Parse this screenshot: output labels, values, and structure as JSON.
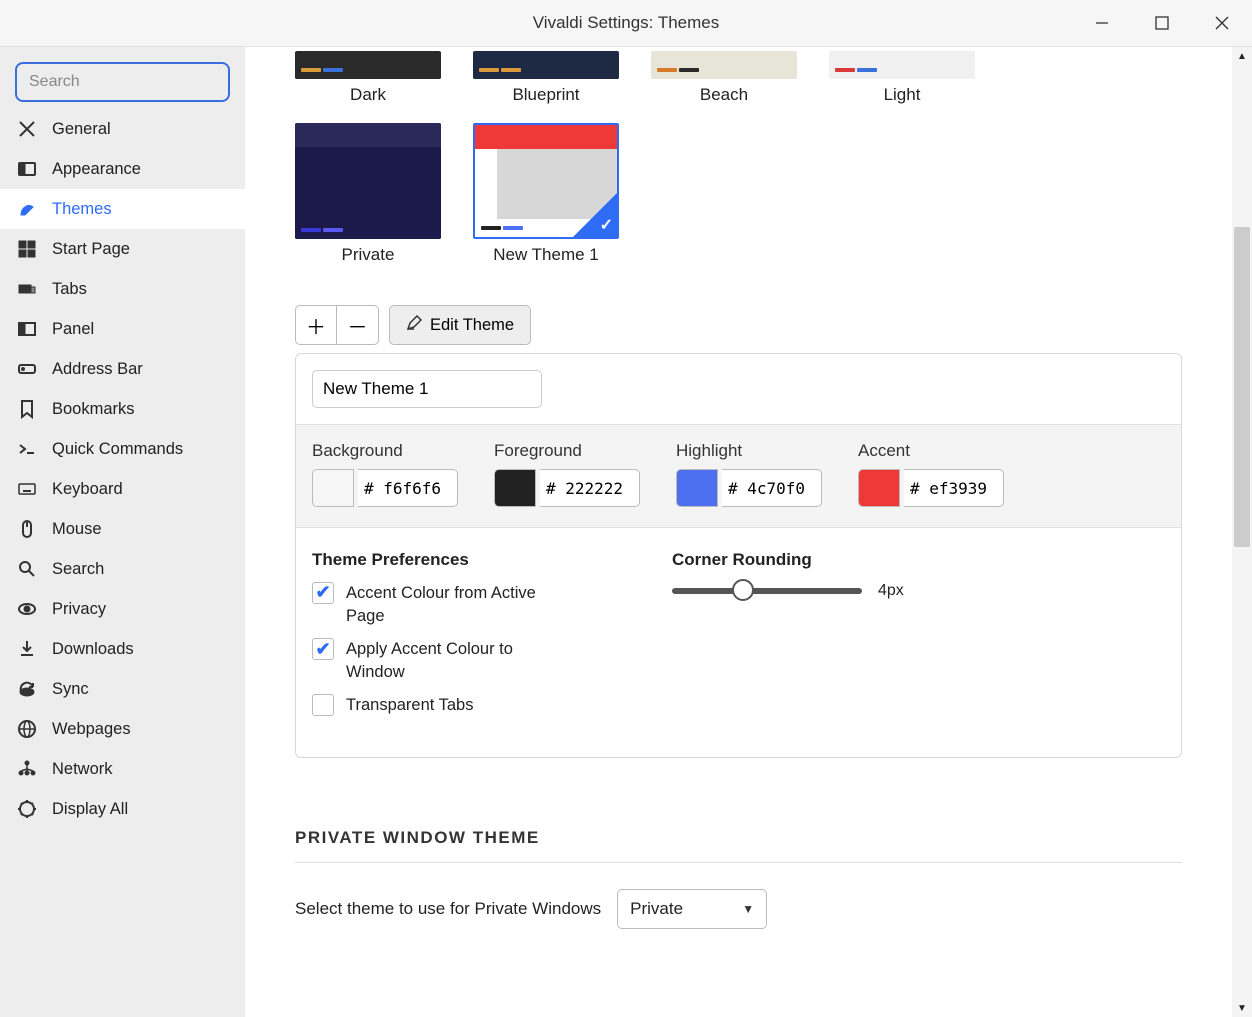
{
  "window": {
    "title": "Vivaldi Settings: Themes"
  },
  "search": {
    "placeholder": "Search"
  },
  "nav": [
    {
      "id": "general",
      "label": "General"
    },
    {
      "id": "appearance",
      "label": "Appearance"
    },
    {
      "id": "themes",
      "label": "Themes"
    },
    {
      "id": "startpage",
      "label": "Start Page"
    },
    {
      "id": "tabs",
      "label": "Tabs"
    },
    {
      "id": "panel",
      "label": "Panel"
    },
    {
      "id": "addressbar",
      "label": "Address Bar"
    },
    {
      "id": "bookmarks",
      "label": "Bookmarks"
    },
    {
      "id": "quickcommands",
      "label": "Quick Commands"
    },
    {
      "id": "keyboard",
      "label": "Keyboard"
    },
    {
      "id": "mouse",
      "label": "Mouse"
    },
    {
      "id": "search",
      "label": "Search"
    },
    {
      "id": "privacy",
      "label": "Privacy"
    },
    {
      "id": "downloads",
      "label": "Downloads"
    },
    {
      "id": "sync",
      "label": "Sync"
    },
    {
      "id": "webpages",
      "label": "Webpages"
    },
    {
      "id": "network",
      "label": "Network"
    },
    {
      "id": "displayall",
      "label": "Display All"
    }
  ],
  "themes": {
    "row1": [
      {
        "id": "dark",
        "label": "Dark",
        "body": "#2a2a2a",
        "strip": "#2a2a2a",
        "tabs": [
          "#d99a3a",
          "#3a72d9"
        ]
      },
      {
        "id": "blueprint",
        "label": "Blueprint",
        "body": "#1e2a44",
        "strip": "#1e2a44",
        "tabs": [
          "#d99a3a",
          "#d99a3a"
        ]
      },
      {
        "id": "beach",
        "label": "Beach",
        "body": "#e7e4d8",
        "strip": "#e7e4d8",
        "tabs": [
          "#d97a2a",
          "#2a2a2a"
        ]
      },
      {
        "id": "light",
        "label": "Light",
        "body": "#f0f0f0",
        "strip": "#f0f0f0",
        "tabs": [
          "#d93a3a",
          "#3a72d9"
        ]
      }
    ],
    "row2": [
      {
        "id": "private",
        "label": "Private",
        "body": "#1b1a4a",
        "strip": "#1b1a4a",
        "topbar": "#2a2a5a",
        "tabs": [
          "#3a3ad9",
          "#5a5af0"
        ]
      },
      {
        "id": "newtheme1",
        "label": "New Theme 1",
        "body": "#d7d7d7",
        "strip": "#ffffff",
        "topbar": "#ef3939",
        "sidebar": "#ffffff",
        "tabs": [
          "#222222",
          "#4c70f0"
        ],
        "selected": true
      }
    ]
  },
  "toolbar": {
    "edit_label": "Edit Theme"
  },
  "editor": {
    "name": "New Theme 1",
    "colors": {
      "background": {
        "label": "Background",
        "hex": "f6f6f6",
        "swatch": "#f6f6f6"
      },
      "foreground": {
        "label": "Foreground",
        "hex": "222222",
        "swatch": "#222222"
      },
      "highlight": {
        "label": "Highlight",
        "hex": "4c70f0",
        "swatch": "#4c70f0"
      },
      "accent": {
        "label": "Accent",
        "hex": "ef3939",
        "swatch": "#ef3939"
      }
    },
    "prefs": {
      "title": "Theme Preferences",
      "items": [
        {
          "id": "accent-from-page",
          "label": "Accent Colour from Active Page",
          "checked": true
        },
        {
          "id": "accent-to-window",
          "label": "Apply Accent Colour to Window",
          "checked": true
        },
        {
          "id": "transparent-tabs",
          "label": "Transparent Tabs",
          "checked": false
        }
      ]
    },
    "corner": {
      "title": "Corner Rounding",
      "value": "4px"
    }
  },
  "private_section": {
    "title": "PRIVATE WINDOW THEME",
    "label": "Select theme to use for Private Windows",
    "selected": "Private"
  }
}
